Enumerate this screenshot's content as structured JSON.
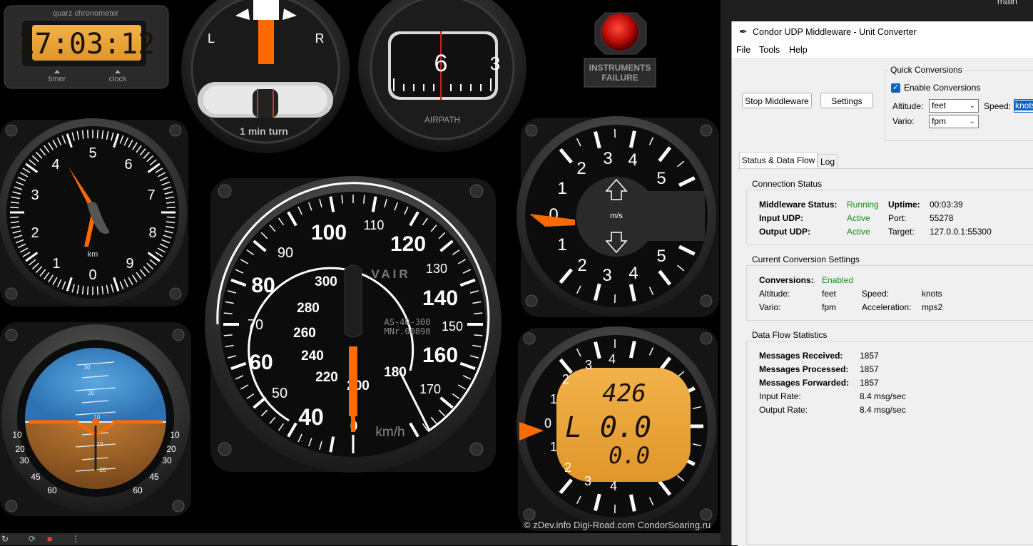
{
  "chronometer": {
    "label": "quarz chronometer",
    "time": "17:03:12",
    "left_button": "timer",
    "right_button": "clock"
  },
  "turn_indicator": {
    "left": "L",
    "right": "R",
    "caption": "1 min turn"
  },
  "airpath": {
    "caption": "AIRPATH",
    "digit": "6",
    "digit_right": "3"
  },
  "failure_lamp": {
    "line1": "INSTRUMENTS",
    "line2": "FAILURE"
  },
  "altimeter": {
    "numbers": [
      "0",
      "1",
      "2",
      "3",
      "4",
      "5",
      "6",
      "7",
      "8",
      "9"
    ],
    "unit": "km"
  },
  "airspeed": {
    "outer_numbers": [
      "40",
      "50",
      "60",
      "70",
      "80",
      "90",
      "100",
      "110",
      "120",
      "130",
      "140",
      "150",
      "160",
      "170"
    ],
    "inner_numbers": [
      "0",
      "200",
      "220",
      "240",
      "260",
      "280",
      "300",
      "180"
    ],
    "brand": "VAIR",
    "model_line1": "AS-40-300",
    "model_line2": "MNr.00898",
    "unit": "km/h"
  },
  "variometer": {
    "unit": "m/s",
    "upper": [
      "0",
      "1",
      "2",
      "3",
      "4",
      "5"
    ],
    "lower": [
      "1",
      "2",
      "3",
      "4",
      "5"
    ]
  },
  "digital_vario": {
    "top_value": "426",
    "mid_prefix": "L",
    "mid_value": "0.0",
    "bottom_value": "0.0",
    "scale_upper": [
      "0",
      "1",
      "2",
      "3",
      "4"
    ],
    "scale_lower": [
      "1",
      "2",
      "3",
      "4"
    ]
  },
  "horizon": {
    "pitch_marks": [
      "30",
      "20",
      "10",
      "10",
      "20",
      "30",
      "40"
    ],
    "bank_marks": [
      "10",
      "20",
      "30",
      "45",
      "60"
    ]
  },
  "credit": "©  zDev.info  Digi-Road.com  CondorSoaring.ru",
  "branch": "main",
  "app": {
    "title": "Condor UDP Middleware - Unit Converter",
    "menu": [
      "File",
      "Tools",
      "Help"
    ],
    "stop_button": "Stop Middleware",
    "settings_button": "Settings",
    "quick": {
      "title": "Quick Conversions",
      "enable_label": "Enable Conversions",
      "altitude_label": "Altitude:",
      "altitude_value": "feet",
      "speed_label": "Speed:",
      "speed_value": "knots",
      "vario_label": "Vario:",
      "vario_value": "fpm"
    },
    "tabs": [
      "Status & Data Flow",
      "Log"
    ],
    "connection": {
      "title": "Connection Status",
      "rows": [
        {
          "label": "Middleware Status:",
          "value": "Running",
          "k2": "Uptime:",
          "v2": "00:03:39"
        },
        {
          "label": "Input UDP:",
          "value": "Active",
          "k2": "Port:",
          "v2": "55278"
        },
        {
          "label": "Output UDP:",
          "value": "Active",
          "k2": "Target:",
          "v2": "127.0.0.1:55300"
        }
      ]
    },
    "current": {
      "title": "Current Conversion Settings",
      "conversions_label": "Conversions:",
      "conversions_value": "Enabled",
      "altitude_label": "Altitude:",
      "altitude_value": "feet",
      "speed_label": "Speed:",
      "speed_value": "knots",
      "vario_label": "Vario:",
      "vario_value": "fpm",
      "accel_label": "Acceleration:",
      "accel_value": "mps2"
    },
    "stats": {
      "title": "Data Flow Statistics",
      "rows": [
        {
          "label": "Messages Received:",
          "value": "1857"
        },
        {
          "label": "Messages Processed:",
          "value": "1857"
        },
        {
          "label": "Messages Forwarded:",
          "value": "1857"
        },
        {
          "label": "Input Rate:",
          "value": "8.4 msg/sec"
        },
        {
          "label": "Output Rate:",
          "value": "8.4 msg/sec"
        }
      ]
    }
  }
}
